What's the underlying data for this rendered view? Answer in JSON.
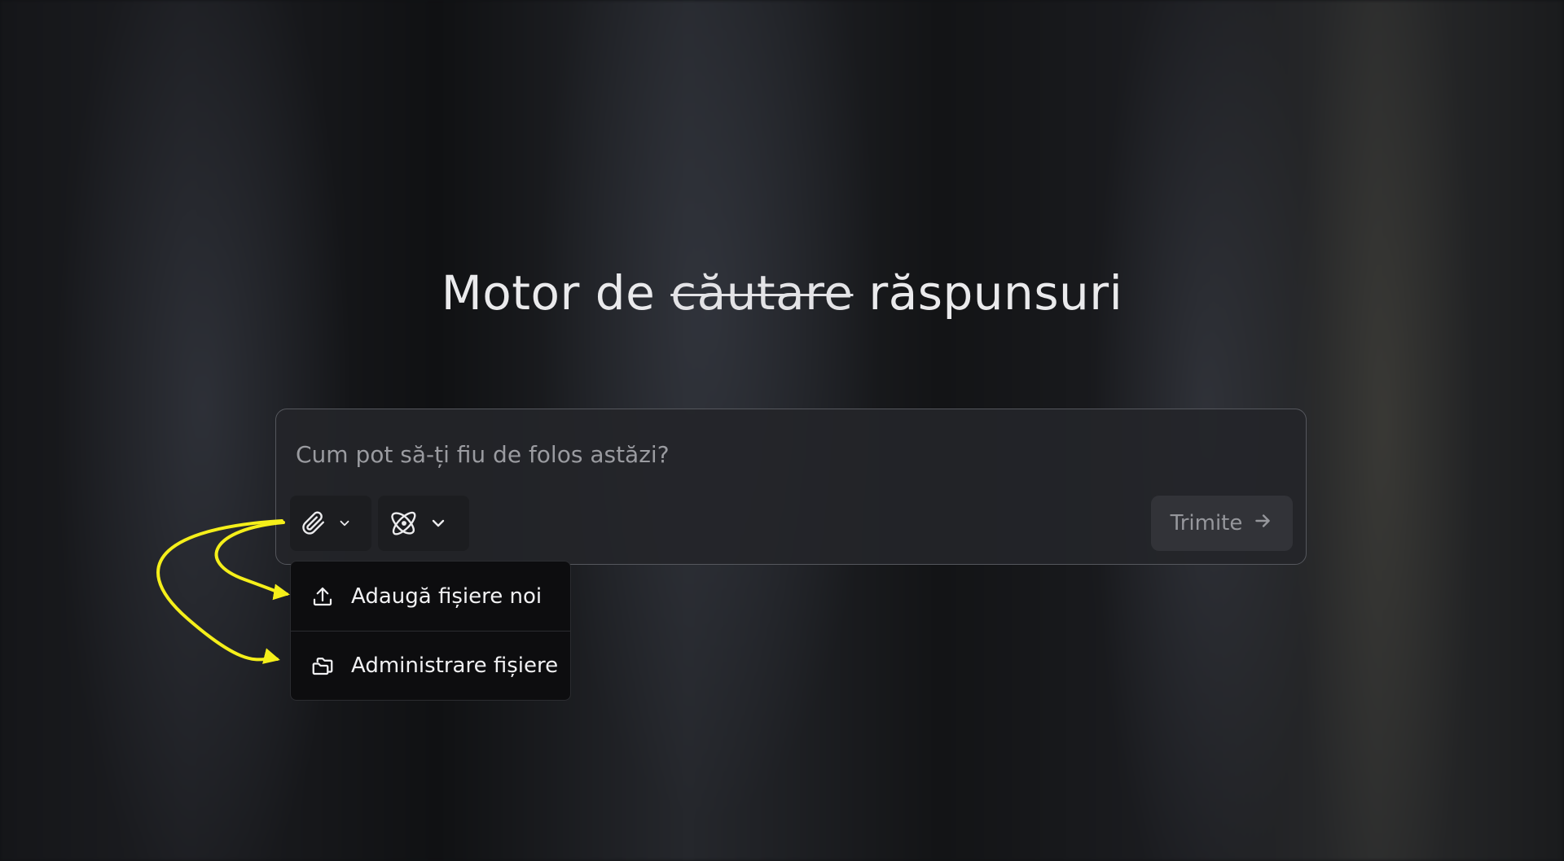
{
  "heading": {
    "prefix": "Motor de",
    "struck": "căutare",
    "suffix": "răspunsuri"
  },
  "composer": {
    "placeholder": "Cum pot să-ți fiu de folos astăzi?",
    "value": "",
    "send_label": "Trimite"
  },
  "toolbar": {
    "attach_icon": "paperclip-icon",
    "model_icon": "atom-icon",
    "chevron_icon": "chevron-down-icon"
  },
  "attach_menu": {
    "items": [
      {
        "label": "Adaugă fișiere noi",
        "icon": "upload-icon"
      },
      {
        "label": "Administrare fișiere",
        "icon": "folders-icon"
      }
    ]
  },
  "annotation": {
    "arrow_color": "#f5ef1a"
  }
}
